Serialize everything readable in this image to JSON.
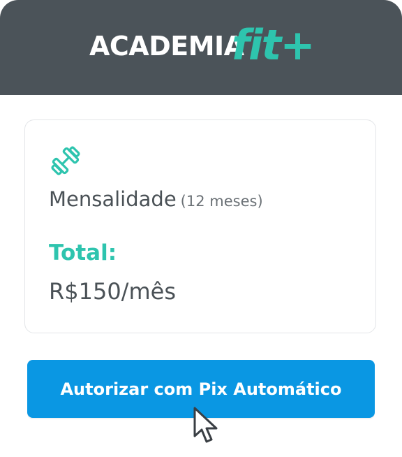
{
  "brand": {
    "name_main": "ACADEMIA",
    "name_accent": "fit+",
    "header_color": "#4b5359",
    "accent_color": "#2ec4ae"
  },
  "plan": {
    "icon": "dumbbell-icon",
    "name": "Mensalidade",
    "duration": "(12 meses)",
    "total_label": "Total:",
    "total_value": "R$150/mês"
  },
  "action": {
    "button_label": "Autorizar com Pix Automático",
    "button_color": "#0a97e3"
  },
  "cursor": {
    "icon": "pointer-cursor-icon"
  }
}
